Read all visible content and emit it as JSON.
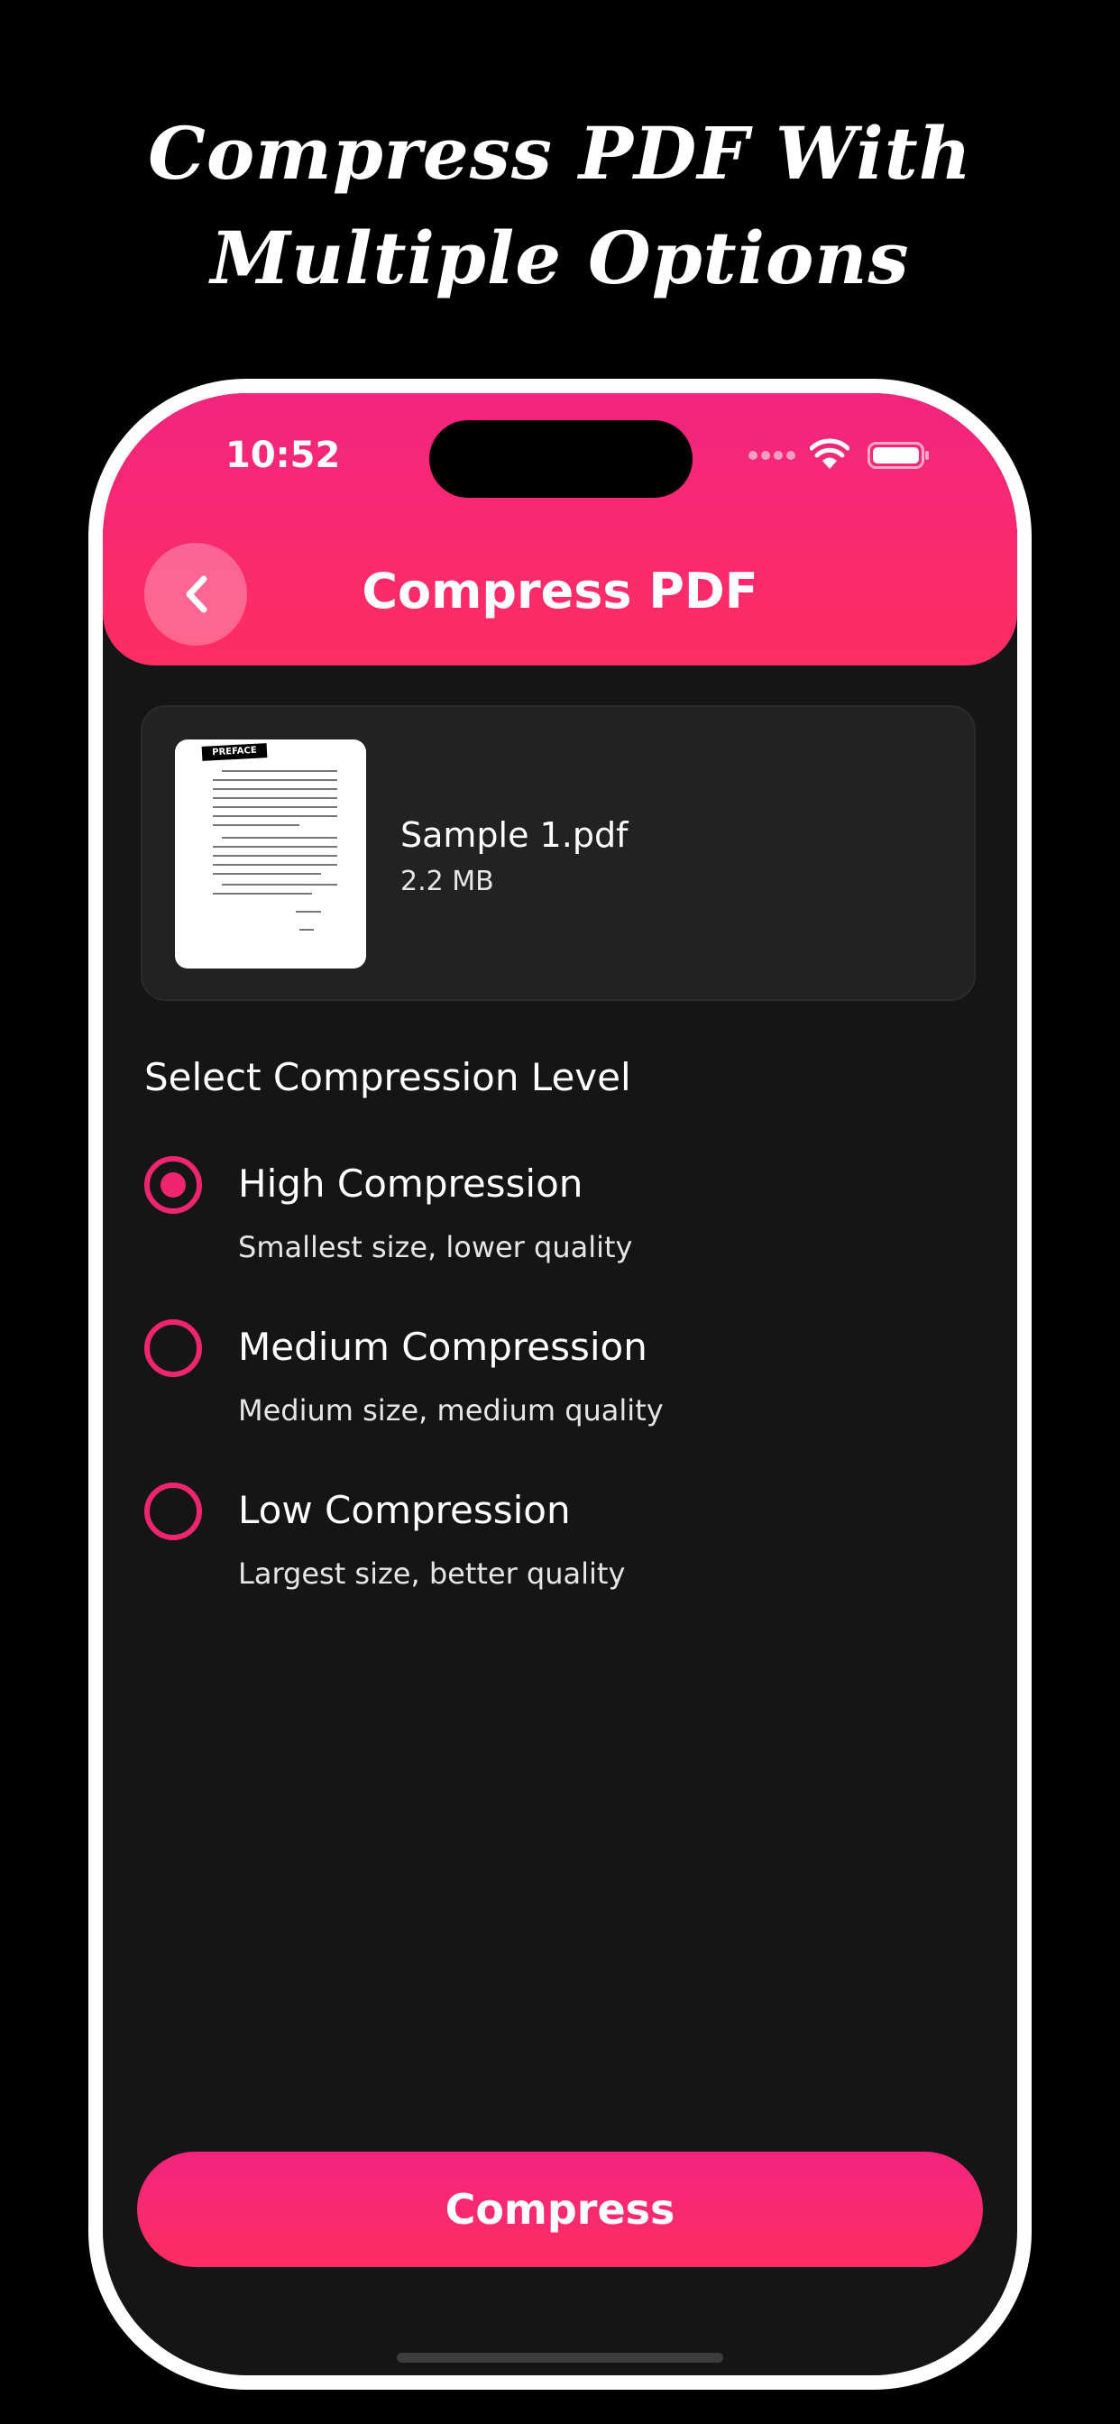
{
  "promo": {
    "title_line1": "Compress PDF With",
    "title_line2": "Multiple Options"
  },
  "status_bar": {
    "time": "10:52"
  },
  "header": {
    "title": "Compress PDF"
  },
  "file": {
    "thumbnail_tag": "PREFACE",
    "name": "Sample 1.pdf",
    "size": "2.2 MB"
  },
  "compression": {
    "section_title": "Select Compression Level",
    "selected": "High Compression",
    "options": [
      {
        "label": "High Compression",
        "description": "Smallest size, lower quality"
      },
      {
        "label": "Medium Compression",
        "description": "Medium size, medium quality"
      },
      {
        "label": "Low Compression",
        "description": "Largest size, better quality"
      }
    ]
  },
  "actions": {
    "compress_label": "Compress"
  },
  "colors": {
    "accent": "#f0256f",
    "header_gradient_top": "#f2257f",
    "header_gradient_bottom": "#ff2d62",
    "screen_background": "#151516",
    "card_background": "#222223"
  }
}
